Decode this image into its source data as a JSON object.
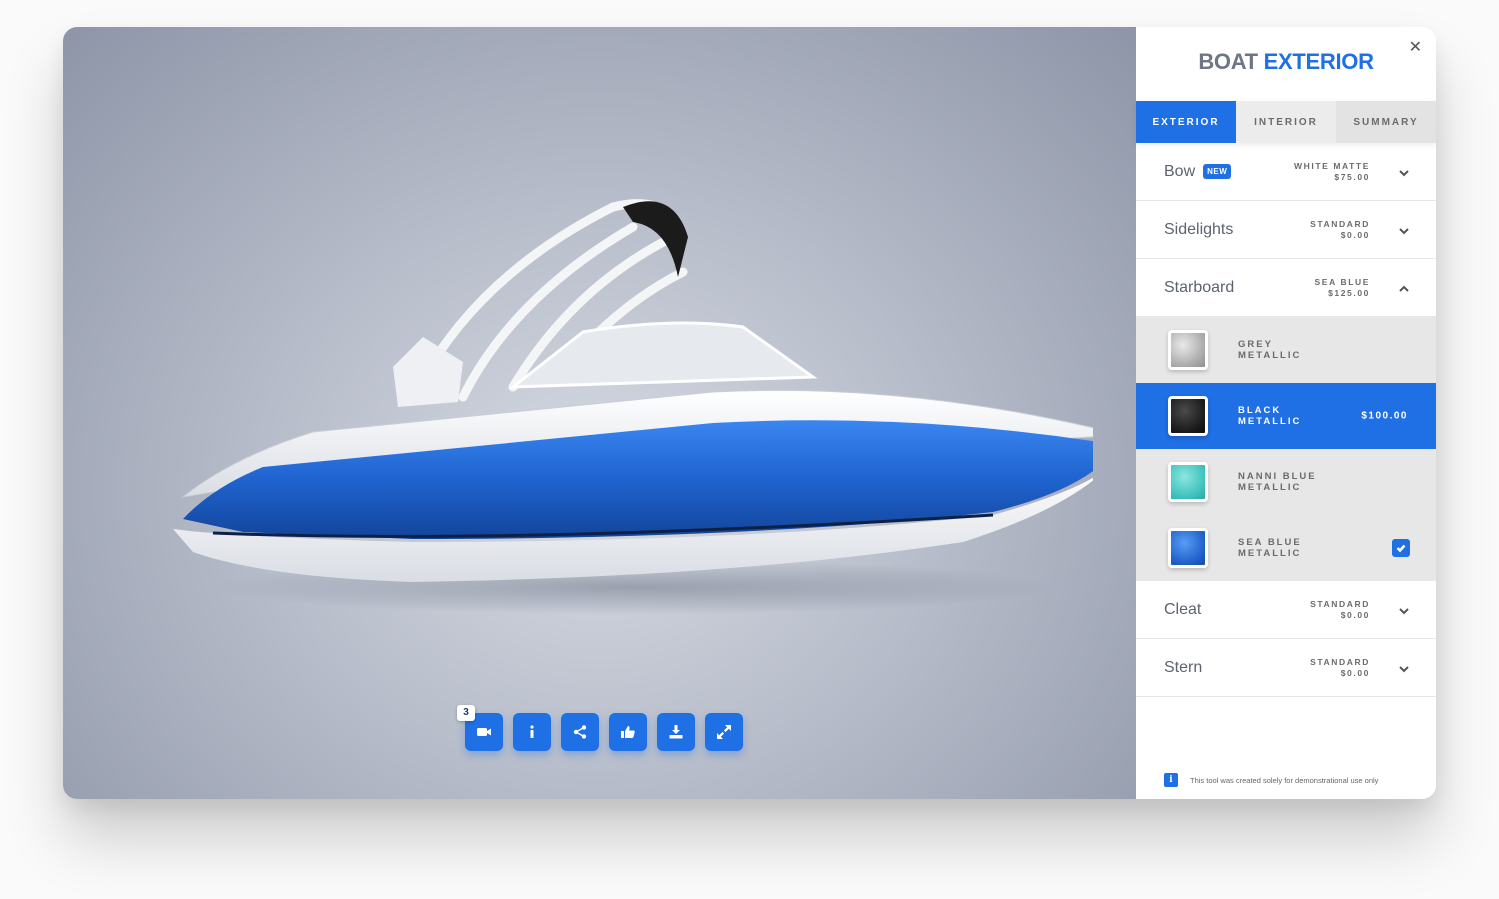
{
  "panel": {
    "title_part1": "BOAT",
    "title_part2": "EXTERIOR",
    "close_label": "✕",
    "tabs": [
      {
        "label": "EXTERIOR",
        "active": true
      },
      {
        "label": "INTERIOR",
        "active": false
      },
      {
        "label": "SUMMARY",
        "active": false
      }
    ],
    "options": [
      {
        "name": "Bow",
        "badge": "NEW",
        "value": "WHITE MATTE",
        "price": "$75.00",
        "expanded": false
      },
      {
        "name": "Sidelights",
        "value": "STANDARD",
        "price": "$0.00",
        "expanded": false
      },
      {
        "name": "Starboard",
        "value": "SEA BLUE",
        "price": "$125.00",
        "expanded": true
      },
      {
        "name": "Cleat",
        "value": "STANDARD",
        "price": "$0.00",
        "expanded": false
      },
      {
        "name": "Stern",
        "value": "STANDARD",
        "price": "$0.00",
        "expanded": false
      }
    ],
    "swatches": [
      {
        "line1": "GREY",
        "line2": "METALLIC",
        "price": "",
        "selected": false,
        "checked": false
      },
      {
        "line1": "BLACK",
        "line2": "METALLIC",
        "price": "$100.00",
        "selected": true,
        "checked": false
      },
      {
        "line1": "NANNI BLUE",
        "line2": "METALLIC",
        "price": "",
        "selected": false,
        "checked": false
      },
      {
        "line1": "SEA BLUE",
        "line2": "METALLIC",
        "price": "",
        "selected": false,
        "checked": true
      }
    ],
    "disclaimer_icon": "i",
    "disclaimer": "This tool was created solely for demonstrational use only"
  },
  "toolbar": {
    "video_badge": "3",
    "icons": [
      "video-camera-icon",
      "info-icon",
      "share-icon",
      "thumbs-up-icon",
      "download-icon",
      "expand-icon"
    ]
  },
  "colors": {
    "accent": "#1f6fe5",
    "hull_blue": "#1f63cf"
  }
}
